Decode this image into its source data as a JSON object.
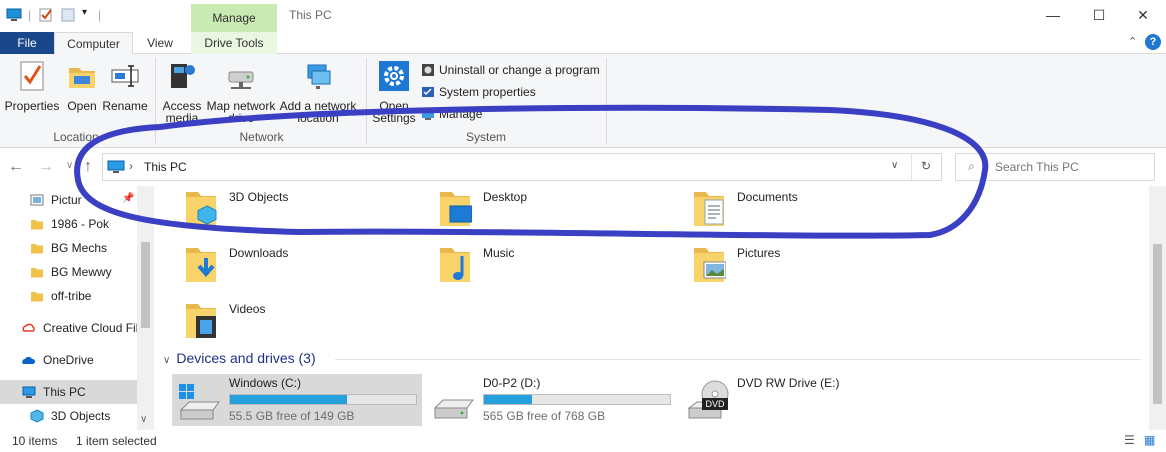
{
  "window": {
    "title": "This PC",
    "context_tab": "Manage",
    "minimize": "—",
    "maximize": "☐",
    "close": "✕"
  },
  "tabs": [
    "File",
    "Computer",
    "View",
    "Drive Tools"
  ],
  "ribbon": {
    "location": {
      "label": "Location",
      "buttons": [
        "Properties",
        "Open",
        "Rename"
      ]
    },
    "network": {
      "label": "Network",
      "buttons": [
        {
          "line1": "Access",
          "line2": "media"
        },
        {
          "line1": "Map network",
          "line2": "drive"
        },
        {
          "line1": "Add a network",
          "line2": "location"
        }
      ]
    },
    "system": {
      "label": "System",
      "open_settings": {
        "line1": "Open",
        "line2": "Settings"
      },
      "commands": [
        "Uninstall or change a program",
        "System properties",
        "Manage"
      ]
    }
  },
  "address": {
    "path": "This PC",
    "search_placeholder": "Search This PC"
  },
  "nav_pane": [
    {
      "label": "Pictur",
      "icon": "pictures-icon"
    },
    {
      "label": "1986 - Pok",
      "icon": "folder-icon"
    },
    {
      "label": "BG Mechs",
      "icon": "folder-icon"
    },
    {
      "label": "BG Mewwy",
      "icon": "folder-icon"
    },
    {
      "label": "off-tribe",
      "icon": "folder-icon"
    },
    {
      "label": "Creative Cloud Fil",
      "icon": "creative-cloud-icon"
    },
    {
      "label": "OneDrive",
      "icon": "onedrive-icon"
    },
    {
      "label": "This PC",
      "icon": "this-pc-icon"
    },
    {
      "label": "3D Objects",
      "icon": "3d-objects-icon"
    }
  ],
  "folders": [
    "3D Objects",
    "Desktop",
    "Documents",
    "Downloads",
    "Music",
    "Pictures",
    "Videos"
  ],
  "devices": {
    "header": "Devices and drives (3)",
    "drives": [
      {
        "name": "Windows (C:)",
        "free": "55.5 GB free of 149 GB",
        "used_fraction": 0.63
      },
      {
        "name": "D0-P2 (D:)",
        "free": "565 GB free of 768 GB",
        "used_fraction": 0.26
      },
      {
        "name": "DVD RW Drive (E:)",
        "badge": "DVD"
      }
    ]
  },
  "status": {
    "items": "10 items",
    "selected": "1 item selected"
  },
  "colors": {
    "accent": "#19478a",
    "context_tab": "#c9eab3",
    "drive_bar": "#26a0da",
    "annotation": "#3a3fc4"
  }
}
